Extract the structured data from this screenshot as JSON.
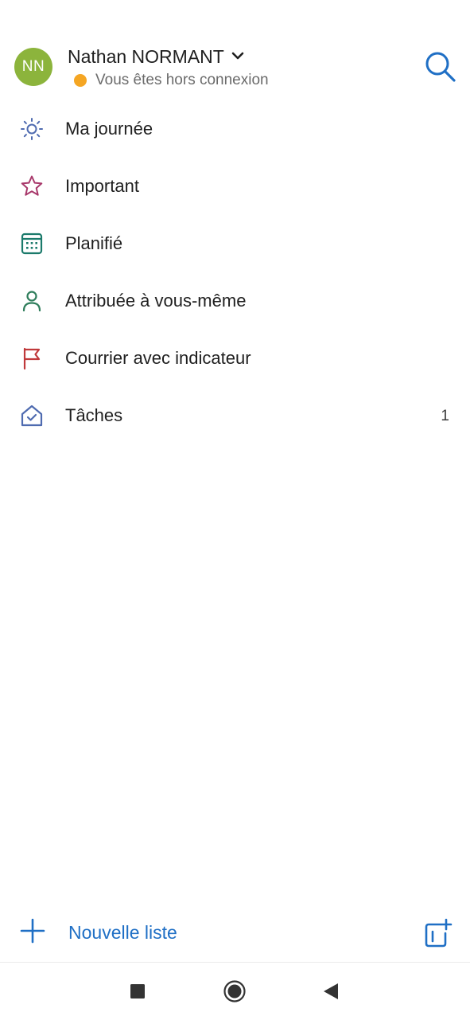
{
  "account": {
    "initials": "NN",
    "name": "Nathan NORMANT",
    "status": "Vous êtes hors connexion"
  },
  "nav": {
    "items": [
      {
        "label": "Ma journée",
        "icon": "sun-icon",
        "color": "#4f6bb0"
      },
      {
        "label": "Important",
        "icon": "star-icon",
        "color": "#a8396b"
      },
      {
        "label": "Planifié",
        "icon": "calendar-icon",
        "color": "#1b7a6b"
      },
      {
        "label": "Attribuée à vous-même",
        "icon": "person-icon",
        "color": "#2e7d5b"
      },
      {
        "label": "Courrier avec indicateur",
        "icon": "flag-icon",
        "color": "#c0393b"
      },
      {
        "label": "Tâches",
        "icon": "home-check-icon",
        "color": "#4f6bb0",
        "count": "1"
      }
    ]
  },
  "footer": {
    "new_list_label": "Nouvelle liste"
  },
  "colors": {
    "accent": "#1f6fc5",
    "avatar": "#8cb43c",
    "offline_dot": "#f5a623"
  }
}
